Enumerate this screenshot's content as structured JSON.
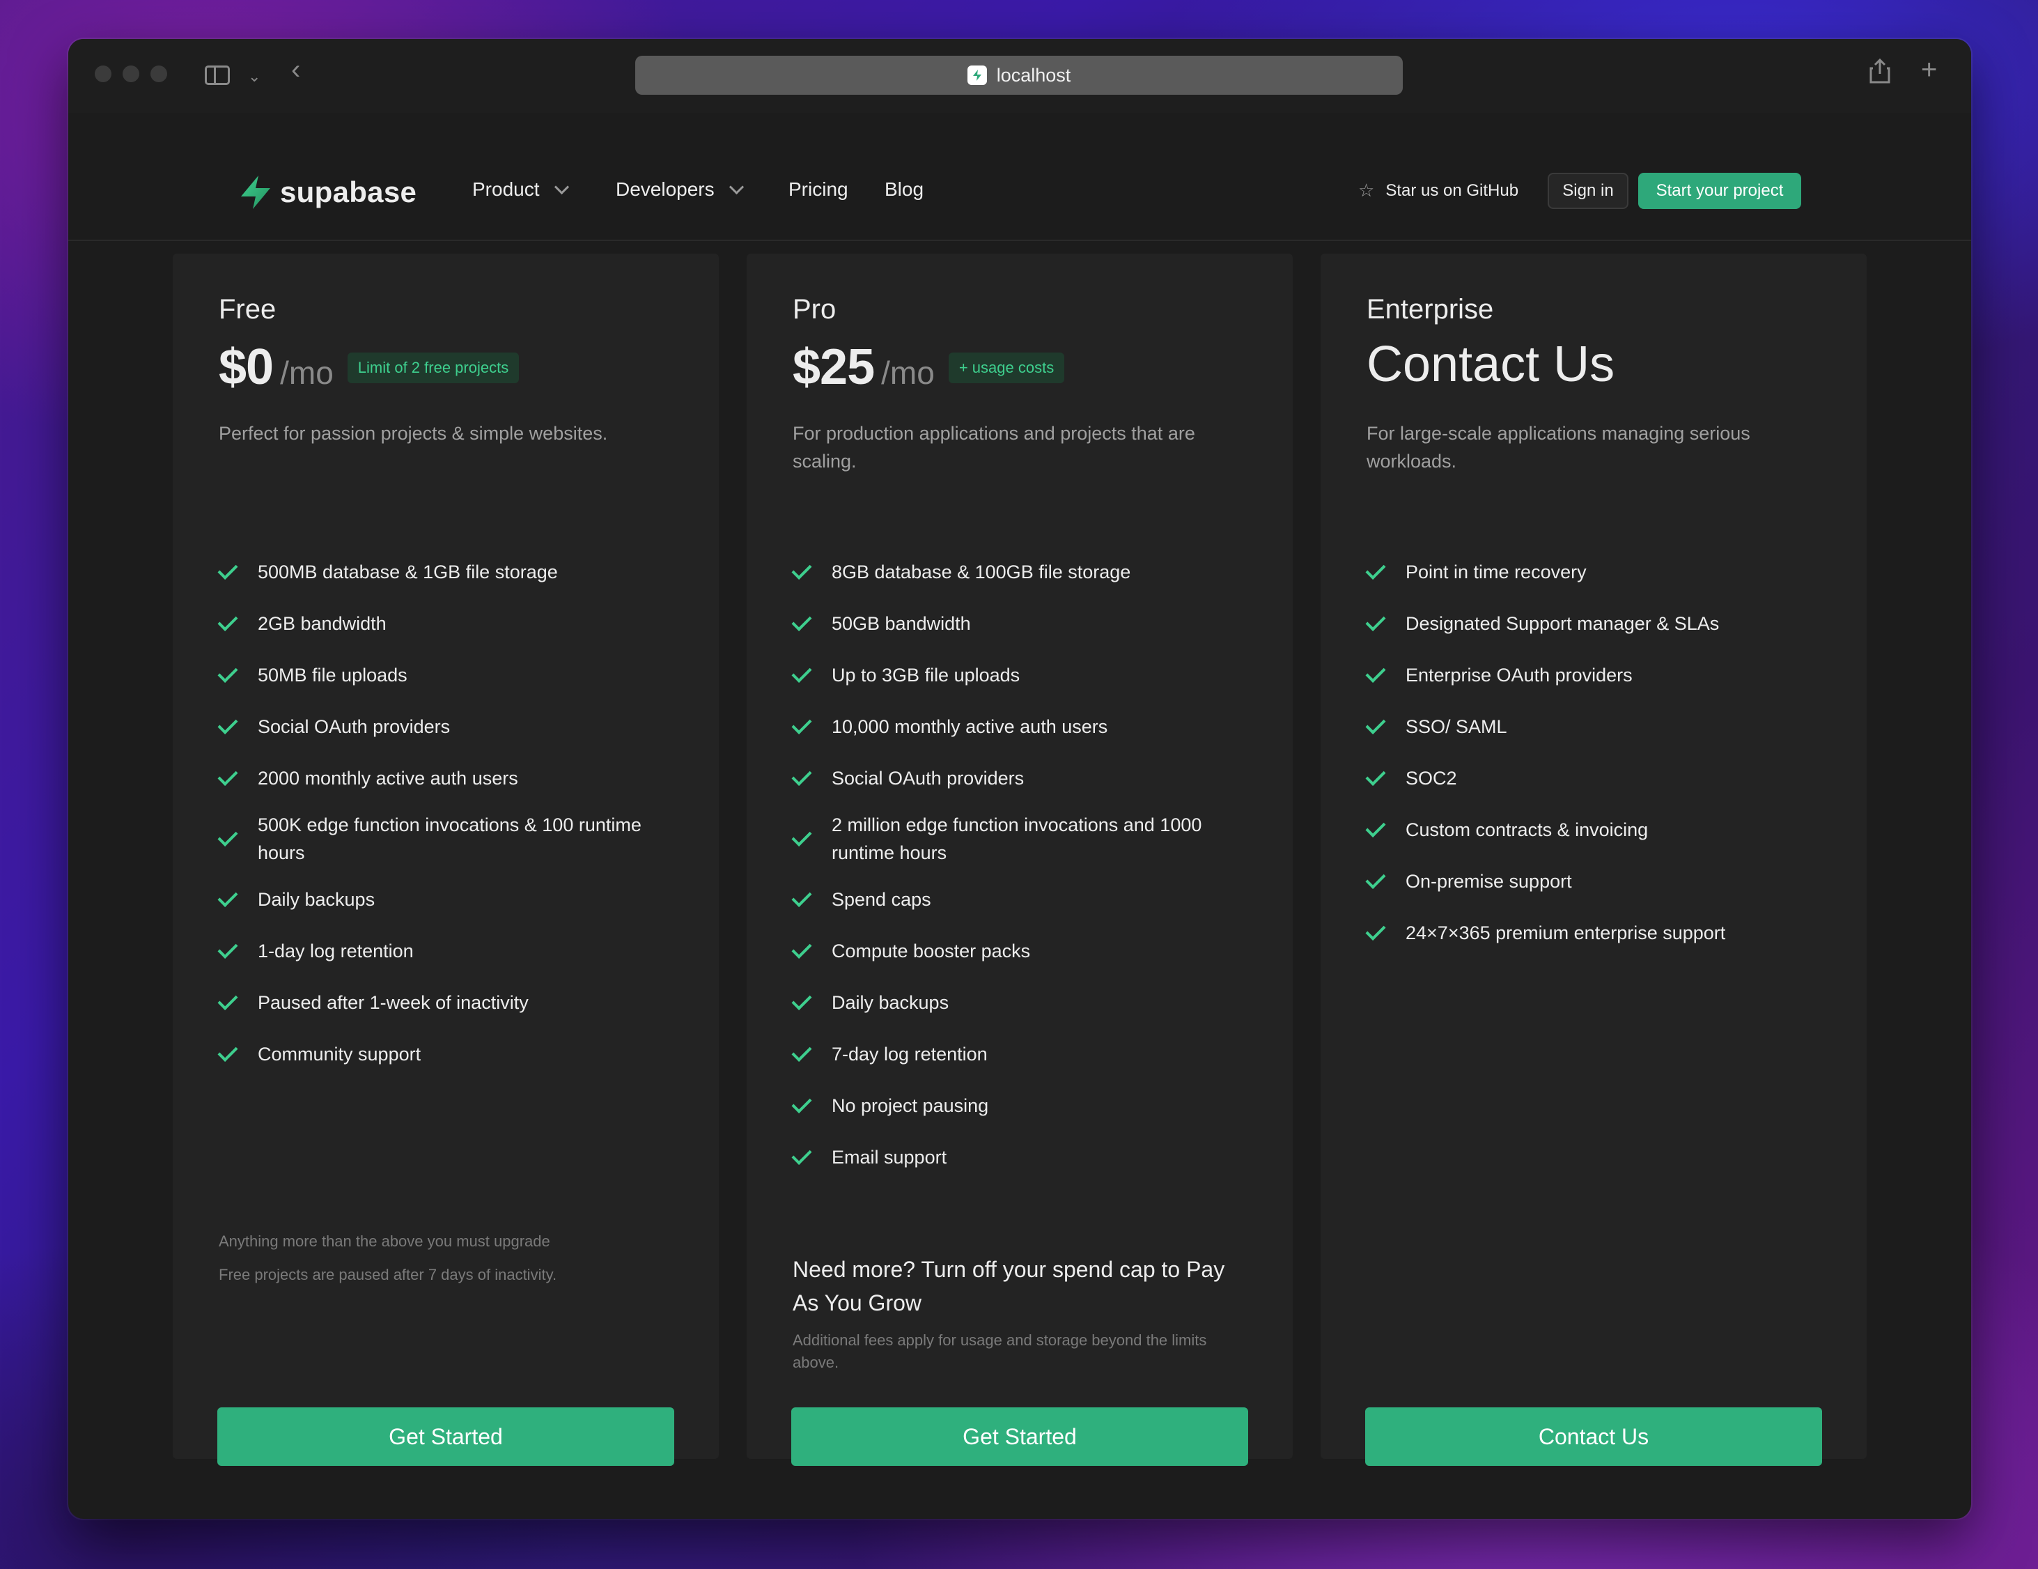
{
  "browser": {
    "address": "localhost"
  },
  "nav": {
    "brand": "supabase",
    "items": [
      {
        "label": "Product",
        "has_dropdown": true
      },
      {
        "label": "Developers",
        "has_dropdown": true
      },
      {
        "label": "Pricing",
        "has_dropdown": false
      },
      {
        "label": "Blog",
        "has_dropdown": false
      }
    ],
    "github_label": "Star us on GitHub",
    "signin_label": "Sign in",
    "start_label": "Start your project"
  },
  "colors": {
    "brand_green": "#3ecf8e",
    "button_green": "#2fb07d",
    "background": "#1c1c1c",
    "card": "#232323"
  },
  "plans": [
    {
      "name": "Free",
      "price": "$0",
      "period": "/mo",
      "tag": "Limit of 2 free projects",
      "description": "Perfect for passion projects & simple websites.",
      "features": [
        "500MB database & 1GB file storage",
        "2GB bandwidth",
        "50MB file uploads",
        "Social OAuth providers",
        "2000 monthly active auth users",
        "500K edge function invocations & 100 runtime hours",
        "Daily backups",
        "1-day log retention",
        "Paused after 1-week of inactivity",
        "Community support"
      ],
      "notes": [
        "Anything more than the above you must upgrade",
        "Free projects are paused after 7 days of inactivity."
      ],
      "cta": "Get Started"
    },
    {
      "name": "Pro",
      "price": "$25",
      "period": "/mo",
      "tag": "+ usage costs",
      "description": "For production applications and projects that are scaling.",
      "features": [
        "8GB database & 100GB file storage",
        "50GB bandwidth",
        "Up to 3GB file uploads",
        "10,000 monthly active auth users",
        "Social OAuth providers",
        "2 million edge function invocations and 1000 runtime hours",
        "Spend caps",
        "Compute booster packs",
        "Daily backups",
        "7-day log retention",
        "No project pausing",
        "Email support"
      ],
      "more_title": "Need more? Turn off your spend cap to Pay As You Grow",
      "more_note": "Additional fees apply for usage and storage beyond the limits above.",
      "cta": "Get Started"
    },
    {
      "name": "Enterprise",
      "headline": "Contact Us",
      "description": "For large-scale applications managing serious workloads.",
      "features": [
        "Point in time recovery",
        "Designated Support manager & SLAs",
        "Enterprise OAuth providers",
        "SSO/ SAML",
        "SOC2",
        "Custom contracts & invoicing",
        "On-premise support",
        "24×7×365 premium enterprise support"
      ],
      "cta": "Contact Us"
    }
  ]
}
